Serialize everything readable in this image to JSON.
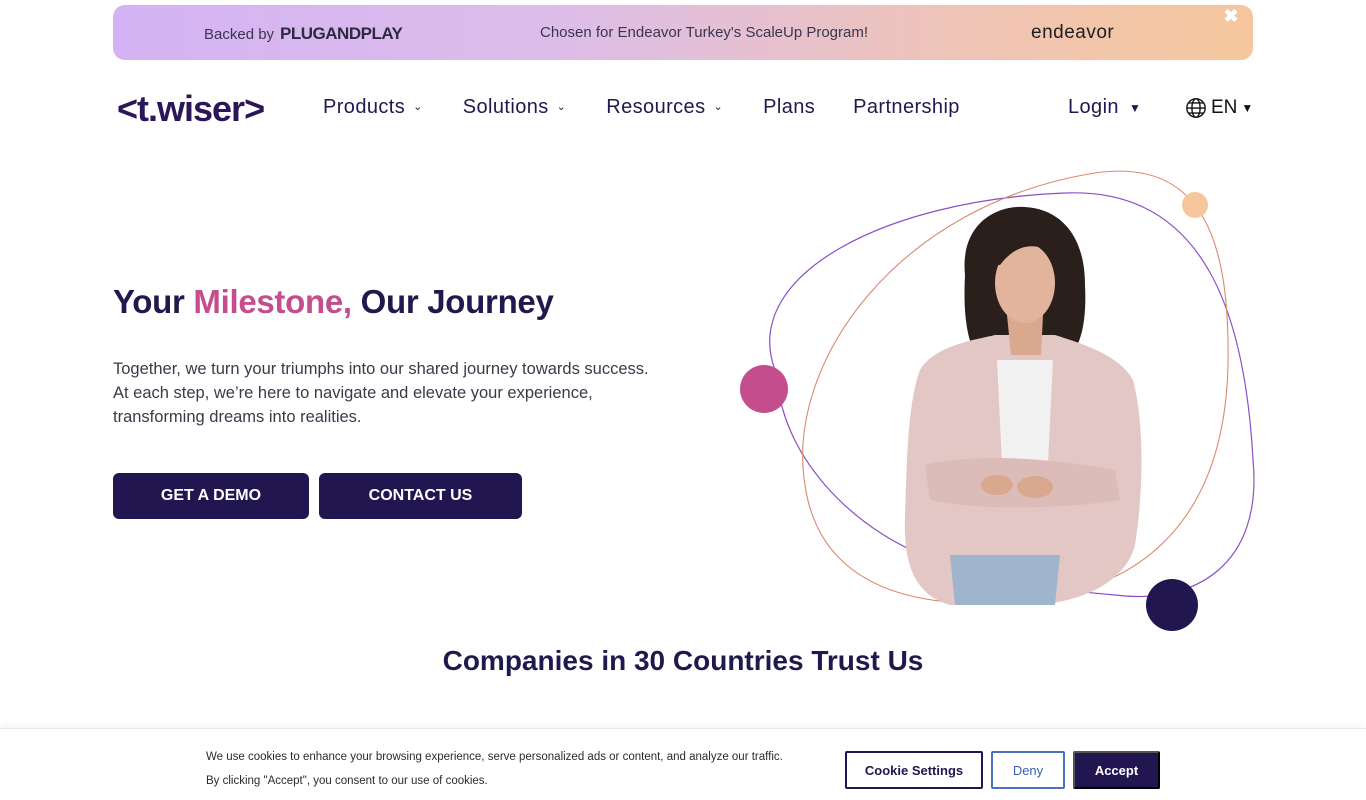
{
  "banner": {
    "backed_label": "Backed by",
    "backed_logo": "PLUGANDPLAY",
    "chosen_text": "Chosen for Endeavor Turkey's ScaleUp Program!",
    "endeavor_logo": "endeavor",
    "close_icon": "close-icon"
  },
  "header": {
    "logo": "<t.wiser>",
    "nav": [
      {
        "label": "Products",
        "dropdown": true
      },
      {
        "label": "Solutions",
        "dropdown": true
      },
      {
        "label": "Resources",
        "dropdown": true
      },
      {
        "label": "Plans",
        "dropdown": false
      },
      {
        "label": "Partnership",
        "dropdown": false
      }
    ],
    "login": "Login",
    "language": "EN",
    "language_icon": "globe-icon"
  },
  "hero": {
    "title_part1": "Your ",
    "title_accent": "Milestone,",
    "title_part2": " Our Journey",
    "description": "Together, we turn your triumphs into our shared journey towards success. At each step, we’re here to navigate and elevate your experience, transforming dreams into realities.",
    "primary_button": "GET A DEMO",
    "secondary_button": "CONTACT US"
  },
  "trust": {
    "heading": "Companies in 30 Countries Trust Us"
  },
  "cookie_banner": {
    "line1": "We use cookies to enhance your browsing experience, serve personalized ads or content, and analyze our traffic.",
    "line2": "By clicking \"Accept\", you consent to our use of cookies.",
    "settings": "Cookie Settings",
    "deny": "Deny",
    "accept": "Accept"
  },
  "colors": {
    "brand_navy": "#21164f",
    "accent_pink": "#c44d8e",
    "accent_peach": "#f6c79d",
    "accent_purple": "#8a4fc7"
  }
}
